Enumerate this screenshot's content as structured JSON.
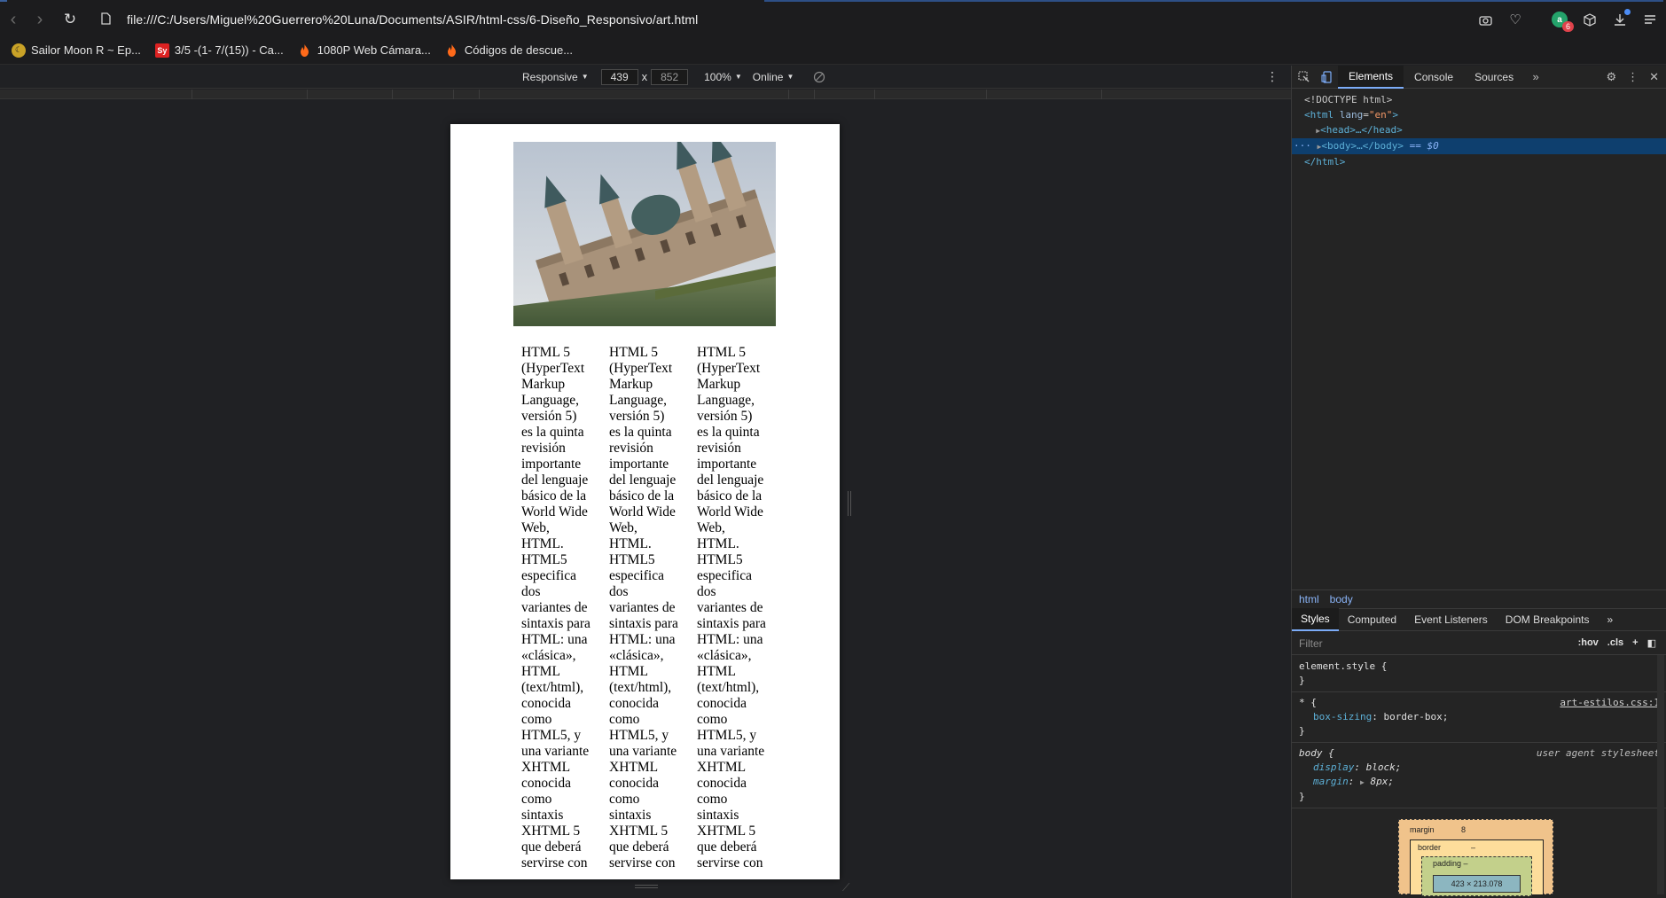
{
  "browser": {
    "url": "file:///C:/Users/Miguel%20Guerrero%20Luna/Documents/ASIR/html-css/6-Diseño_Responsivo/art.html",
    "extension_badge": "6"
  },
  "bookmarks": [
    {
      "label": "Sailor Moon R ~ Ep...",
      "icon": "moon-icon"
    },
    {
      "label": "3/5 -(1- 7/(15)) - Ca...",
      "icon": "symbolab-icon",
      "icon_text": "Sy"
    },
    {
      "label": "1080P Web Cámara...",
      "icon": "fire-icon"
    },
    {
      "label": "Códigos de descue...",
      "icon": "fire-icon"
    }
  ],
  "device_toolbar": {
    "mode": "Responsive",
    "width": "439",
    "height": "852",
    "separator": "x",
    "zoom": "100%",
    "network": "Online"
  },
  "page_content": {
    "column_text": "HTML 5 (HyperText Markup Language, versión 5) es la quinta revisión importante del lenguaje básico de la World Wide Web, HTML. HTML5 especifica dos variantes de sintaxis para HTML: una «clásica», HTML (text/html), conocida como HTML5, y una variante XHTML conocida como sintaxis XHTML 5 que deberá servirse con"
  },
  "devtools": {
    "tabs": [
      "Elements",
      "Console",
      "Sources"
    ],
    "selected_tab": "Elements",
    "dom": {
      "doctype": "<!DOCTYPE html>",
      "html_open_tag": "<html",
      "html_attr": "lang",
      "html_attr_val": "\"en\"",
      "html_open_close": ">",
      "head": "<head>…</head>",
      "body": "<body>…</body>",
      "body_marker": "== $0",
      "html_close": "</html>"
    },
    "breadcrumbs": [
      "html",
      "body"
    ],
    "style_tabs": [
      "Styles",
      "Computed",
      "Event Listeners",
      "DOM Breakpoints"
    ],
    "filter_placeholder": "Filter",
    "filter_tools": [
      ":hov",
      ".cls",
      "+"
    ],
    "rules": {
      "element_style_selector": "element.style {",
      "universal_selector": "* {",
      "universal_source": "art-estilos.css:1",
      "universal_prop": "box-sizing",
      "universal_val": "border-box;",
      "body_selector": "body {",
      "body_source": "user agent stylesheet",
      "body_prop1": "display",
      "body_val1": "block;",
      "body_prop2": "margin",
      "body_val2": "8px;",
      "close": "}"
    },
    "box_model": {
      "margin_label": "margin",
      "margin_value": "8",
      "border_label": "border",
      "border_value": "–",
      "padding_label": "padding –",
      "content_size": "423 × 213.078"
    }
  }
}
